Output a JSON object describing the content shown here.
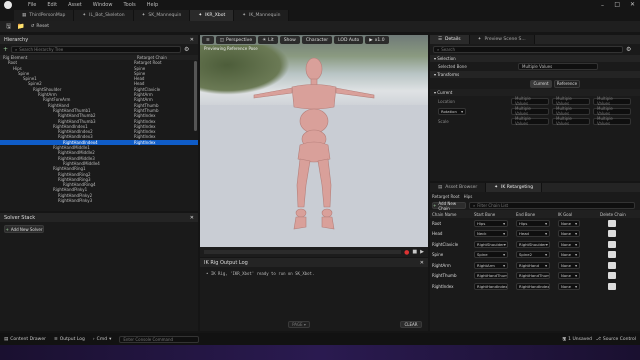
{
  "menu": [
    "File",
    "Edit",
    "Asset",
    "Window",
    "Tools",
    "Help"
  ],
  "tabs": [
    {
      "label": "ThirdPersonMap",
      "active": false
    },
    {
      "label": "IL_Bot_Skeleton",
      "active": false
    },
    {
      "label": "SK_Mannequin",
      "active": false
    },
    {
      "label": "IKR_Xbot",
      "active": true
    },
    {
      "label": "IK_Mannequin",
      "active": false
    }
  ],
  "toolbar": {
    "save_label": "",
    "reset_label": "Reset"
  },
  "hierarchy": {
    "title": "Hierarchy",
    "search_placeholder": "Search Hierarchy Tree",
    "col_element": "Rig Element",
    "col_chain": "Retarget Chain",
    "rows": [
      {
        "indent": 1,
        "name": "Root",
        "chain": "Retarget Root"
      },
      {
        "indent": 2,
        "name": "Hips",
        "chain": "Spine"
      },
      {
        "indent": 3,
        "name": "Spine",
        "chain": "Spine"
      },
      {
        "indent": 4,
        "name": "Spine1",
        "chain": "Head"
      },
      {
        "indent": 5,
        "name": "Spine2",
        "chain": "Head"
      },
      {
        "indent": 6,
        "name": "RightShoulder",
        "chain": "RightClavicle"
      },
      {
        "indent": 7,
        "name": "RightArm",
        "chain": "RightArm"
      },
      {
        "indent": 8,
        "name": "RightForeArm",
        "chain": "RightArm"
      },
      {
        "indent": 9,
        "name": "RightHand",
        "chain": "RightThumb"
      },
      {
        "indent": 10,
        "name": "RightHandThumb1",
        "chain": "RightThumb"
      },
      {
        "indent": 11,
        "name": "RightHandThumb2",
        "chain": "RightIndex"
      },
      {
        "indent": 11,
        "name": "RightHandThumb3",
        "chain": "RightIndex"
      },
      {
        "indent": 10,
        "name": "RightHandIndex1",
        "chain": "RightIndex"
      },
      {
        "indent": 11,
        "name": "RightHandIndex2",
        "chain": "RightIndex"
      },
      {
        "indent": 11,
        "name": "RightHandIndex3",
        "chain": "RightIndex"
      },
      {
        "indent": 12,
        "name": "RightHandIndex4",
        "chain": "RightIndex",
        "selected": true
      },
      {
        "indent": 10,
        "name": "RightHandMiddle1",
        "chain": ""
      },
      {
        "indent": 11,
        "name": "RightHandMiddle2",
        "chain": ""
      },
      {
        "indent": 11,
        "name": "RightHandMiddle3",
        "chain": ""
      },
      {
        "indent": 12,
        "name": "RightHandMiddle4",
        "chain": ""
      },
      {
        "indent": 10,
        "name": "RightHandRing1",
        "chain": ""
      },
      {
        "indent": 11,
        "name": "RightHandRing2",
        "chain": ""
      },
      {
        "indent": 11,
        "name": "RightHandRing3",
        "chain": ""
      },
      {
        "indent": 12,
        "name": "RightHandRing4",
        "chain": ""
      },
      {
        "indent": 10,
        "name": "RightHandPinky1",
        "chain": ""
      },
      {
        "indent": 11,
        "name": "RightHandPinky2",
        "chain": ""
      },
      {
        "indent": 11,
        "name": "RightHandPinky3",
        "chain": ""
      }
    ]
  },
  "solver": {
    "title": "Solver Stack",
    "add_label": "Add New Solver"
  },
  "viewport": {
    "perspective": "Perspective",
    "lit": "Lit",
    "show": "Show",
    "character": "Character",
    "lod": "LOD Auto",
    "speed": "x1.0",
    "preview_label": "Previewing Reference Pose"
  },
  "log": {
    "title": "IK Rig Output Log",
    "line": "• IK Rig, 'IKR_Xbot' ready to run on SK_Xbot.",
    "page_label": "PAGE ▾",
    "clear_label": "CLEAR"
  },
  "details": {
    "tab1": "Details",
    "tab2": "Preview Scene S...",
    "search_placeholder": "Search",
    "selection_header": "Selection",
    "selected_bone_label": "Selected Bone",
    "selected_bone_value": "Multiple Values",
    "transforms_header": "Transforms",
    "current_label": "Current",
    "reference_label": "Reference",
    "current_header": "Current",
    "location_label": "Location",
    "rotation_label": "Rotation",
    "scale_label": "Scale",
    "multiple_values": "Multiple Values"
  },
  "retarget": {
    "tab1": "Asset Browser",
    "tab2": "IK Retargeting",
    "root_label": "Retarget Root",
    "root_value": "Hips",
    "add_chain_label": "Add New Chain",
    "filter_placeholder": "Filter Chain List",
    "columns": [
      "Chain Name",
      "Start Bone",
      "End Bone",
      "IK Goal",
      "Delete Chain"
    ],
    "chains": [
      {
        "name": "Root",
        "start": "Hips",
        "end": "Hips",
        "goal": "None"
      },
      {
        "name": "Head",
        "start": "Neck",
        "end": "Head",
        "goal": "None"
      },
      {
        "name": "RightClavicle",
        "start": "RightShoulder",
        "end": "RightShoulder",
        "goal": "None"
      },
      {
        "name": "Spine",
        "start": "Spine",
        "end": "Spine2",
        "goal": "None"
      },
      {
        "name": "RightArm",
        "start": "RightArm",
        "end": "RightHand",
        "goal": "None"
      },
      {
        "name": "RightThumb",
        "start": "RightHandThumb1",
        "end": "RightHandThumb4",
        "goal": "None"
      },
      {
        "name": "RightIndex",
        "start": "RightHandIndex1",
        "end": "RightHandIndex4",
        "goal": "None"
      }
    ]
  },
  "status": {
    "drawer": "Content Drawer",
    "output": "Output Log",
    "cmd": "Cmd",
    "cmd_placeholder": "Enter Console Command",
    "unsaved": "1 Unsaved",
    "source": "Source Control"
  }
}
